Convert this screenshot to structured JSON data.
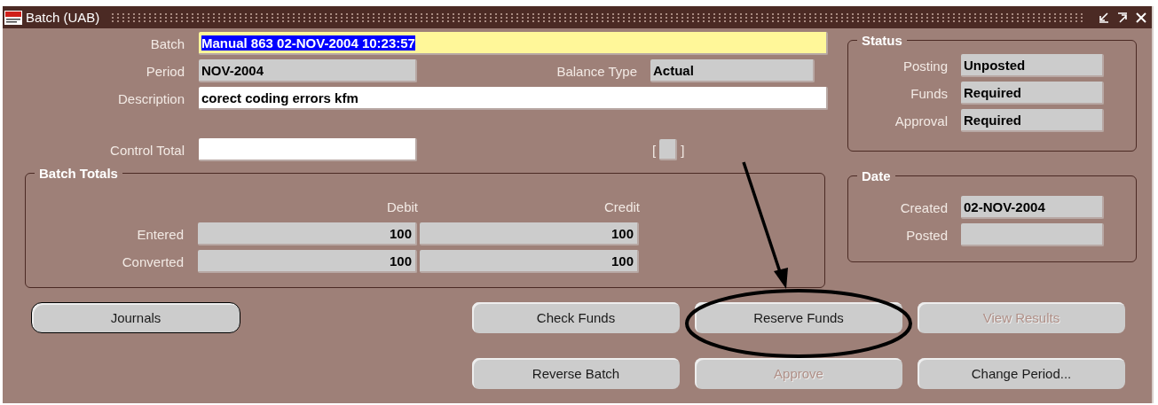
{
  "window": {
    "title": "Batch (UAB)"
  },
  "batch": {
    "label": "Batch",
    "value": "Manual 863 02-NOV-2004 10:23:57",
    "kind": "current",
    "selected": true
  },
  "period": {
    "label": "Period",
    "value": "NOV-2004",
    "kind": "readonly"
  },
  "balance_type": {
    "label": "Balance Type",
    "value": "Actual",
    "kind": "readonly"
  },
  "description": {
    "label": "Description",
    "value": "corect coding errors kfm",
    "kind": "editable"
  },
  "control_total": {
    "label": "Control Total",
    "kind": "editable"
  },
  "bracket_item": {
    "open": "[",
    "close": "]"
  },
  "batch_totals": {
    "title": "Batch Totals",
    "columns": [
      "Debit",
      "Credit"
    ],
    "rows": [
      {
        "label": "Entered",
        "values": [
          "100",
          "100"
        ]
      },
      {
        "label": "Converted",
        "values": [
          "100",
          "100"
        ]
      }
    ]
  },
  "status": {
    "title": "Status",
    "fields": [
      {
        "label": "Posting",
        "value": "Unposted"
      },
      {
        "label": "Funds",
        "value": "Required"
      },
      {
        "label": "Approval",
        "value": "Required"
      }
    ]
  },
  "date": {
    "title": "Date",
    "fields": [
      {
        "label": "Created",
        "value": "02-NOV-2004"
      },
      {
        "label": "Posted"
      }
    ]
  },
  "button_rows": [
    [
      {
        "label": "Journals",
        "disabled": false,
        "focused": true
      },
      {
        "label": "Check Funds",
        "disabled": false,
        "focused": false
      },
      {
        "label": "Reserve Funds",
        "disabled": false,
        "focused": false
      },
      {
        "label": "View Results",
        "disabled": true,
        "focused": false
      }
    ],
    [
      {
        "label": "Reverse Batch",
        "disabled": false,
        "focused": false
      },
      {
        "label": "Approve",
        "disabled": true,
        "focused": false
      },
      {
        "label": "Change Period...",
        "disabled": false,
        "focused": false
      }
    ]
  ]
}
